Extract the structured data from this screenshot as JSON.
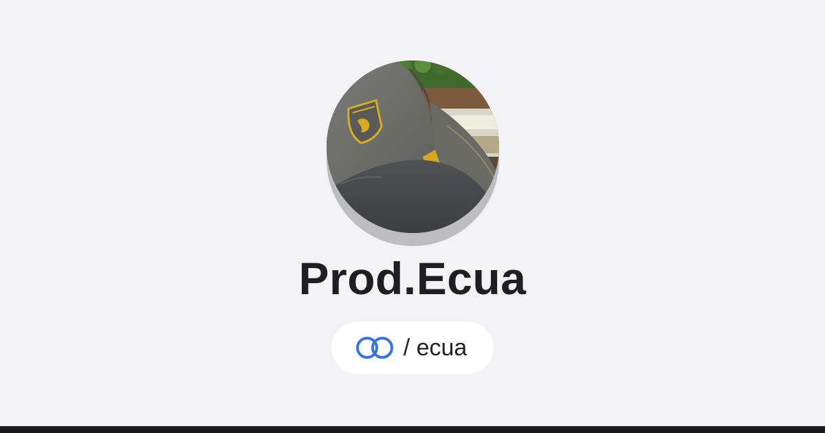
{
  "profile": {
    "display_name": "Prod.Ecua",
    "handle": "/ ecua",
    "avatar_alt": "Prod.Ecua"
  },
  "icons": {
    "link": "linked-rings-icon",
    "avatar": "profile-photo"
  },
  "colors": {
    "background": "#f3f3f6",
    "text": "#1f1f21",
    "link_icon": "#3a73e0",
    "pill": "#ffffff",
    "bottom_bar": "#1a1a1c"
  }
}
